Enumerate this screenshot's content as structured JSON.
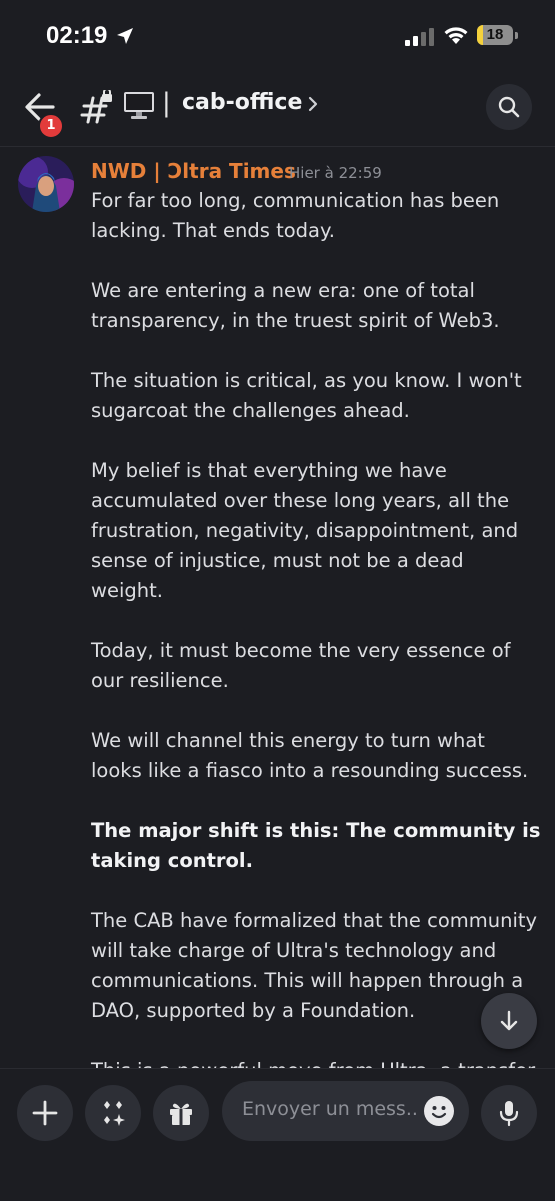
{
  "status_bar": {
    "time": "02:19",
    "battery": "18",
    "battery_fraction": 0.18
  },
  "header": {
    "notification_count": "1",
    "separator": "|",
    "channel_name": "cab-office",
    "icons": [
      "back-arrow-icon",
      "locked-hash-icon",
      "monitor-icon",
      "chevron-right-icon",
      "search-icon"
    ]
  },
  "message": {
    "author": "NWD | Ɔltra Times",
    "timestamp": "Hier à 22:59",
    "paragraphs": [
      "For far too long, communication has been lacking. That ends today.",
      "We are entering a new era: one of total transparency, in the truest spirit of Web3.",
      "The situation is critical, as you know. I won't sugarcoat the challenges ahead.",
      "My belief is that everything we have accumulated over these long years, all the frustration, negativity, disappointment, and sense of injustice, must not be a dead weight.",
      "Today, it must become the very essence of our resilience.",
      "We will channel this energy to turn what looks like a fiasco into a resounding success.",
      "The major shift is this: The community is taking control.",
      "The CAB have formalized that the community will take charge of Ultra's technology and communications. This will happen through a DAO, supported by a Foundation.",
      "This is a powerful move from Ultra, a transfer of the vision and assets into the hands of"
    ]
  },
  "composer": {
    "placeholder": "Envoyer un mess..",
    "icons": [
      "plus-icon",
      "apps-icon",
      "gift-icon",
      "emoji-icon",
      "microphone-icon"
    ]
  },
  "colors": {
    "background": "#1c1d22",
    "author": "#e6803a",
    "badge": "#e23b3b",
    "battery": "#f4d13c"
  }
}
